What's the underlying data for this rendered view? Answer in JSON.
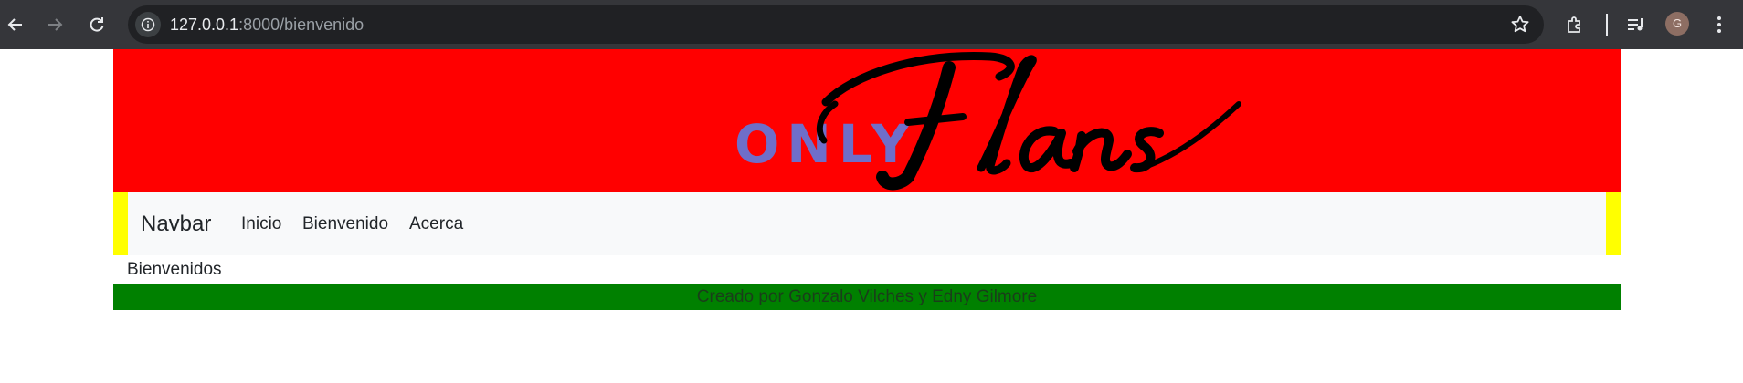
{
  "browser": {
    "url_host": "127.0.0.1",
    "url_path": ":8000/bienvenido",
    "profile_initial": "G",
    "icons": [
      "back-icon",
      "forward-icon",
      "reload-icon",
      "site-info-icon",
      "bookmark-star-icon",
      "extensions-icon",
      "reading-list-icon",
      "menu-icon"
    ]
  },
  "header": {
    "logo_only": "ONLY",
    "logo_script": "Flans",
    "colors": {
      "banner": "#ff0000",
      "only_text": "#6f6ec9",
      "script_text": "#000000"
    }
  },
  "navbar": {
    "brand": "Navbar",
    "links": [
      "Inicio",
      "Bienvenido",
      "Acerca"
    ],
    "colors": {
      "side_strip": "#ffff00",
      "background": "#f8f9fa"
    }
  },
  "main": {
    "welcome_text": "Bienvenidos"
  },
  "footer": {
    "text": "Creado por Gonzalo Vilches y Edny Gilmore",
    "color": "#008000"
  }
}
